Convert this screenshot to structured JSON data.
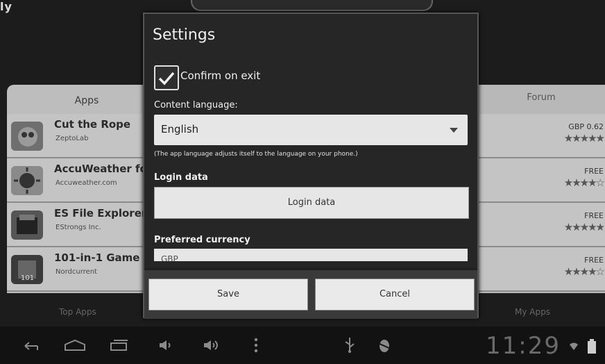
{
  "window": {
    "corner_text": "ly"
  },
  "apps_pane": {
    "header": "Apps",
    "items": [
      {
        "title": "Cut the Rope",
        "developer": "ZeptoLab",
        "icon": "cut-the-rope-icon"
      },
      {
        "title": "AccuWeather fo",
        "developer": "Accuweather.com",
        "icon": "accuweather-icon"
      },
      {
        "title": "ES File Explorer",
        "developer": "EStrongs Inc.",
        "icon": "es-file-explorer-icon"
      },
      {
        "title": "101-in-1 Game",
        "developer": "Nordcurrent",
        "icon": "game-icon"
      }
    ]
  },
  "forum_pane": {
    "header": "Forum",
    "rows": [
      {
        "price": "GBP 0.62",
        "stars": "★★★★★"
      },
      {
        "price": "FREE",
        "stars": "★★★★☆"
      },
      {
        "price": "FREE",
        "stars": "★★★★★"
      },
      {
        "price": "FREE",
        "stars": "★★★★☆"
      }
    ]
  },
  "bottom_tabs": {
    "left": "Top Apps",
    "right": "My Apps"
  },
  "dialog": {
    "title": "Settings",
    "confirm_exit": {
      "label": "Confirm on exit",
      "checked": true
    },
    "content_language": {
      "label": "Content language:",
      "value": "English",
      "hint": "(The app language adjusts itself to the language on your phone.)"
    },
    "login": {
      "label": "Login data",
      "button": "Login data"
    },
    "currency": {
      "label": "Preferred currency",
      "value": "GBP"
    },
    "buttons": {
      "save": "Save",
      "cancel": "Cancel"
    }
  },
  "status_bar": {
    "time": "11:29"
  },
  "colors": {
    "dialog_bg": "#262626",
    "button_bg": "#eaeaea",
    "list_bg": "#c4c4c4"
  }
}
